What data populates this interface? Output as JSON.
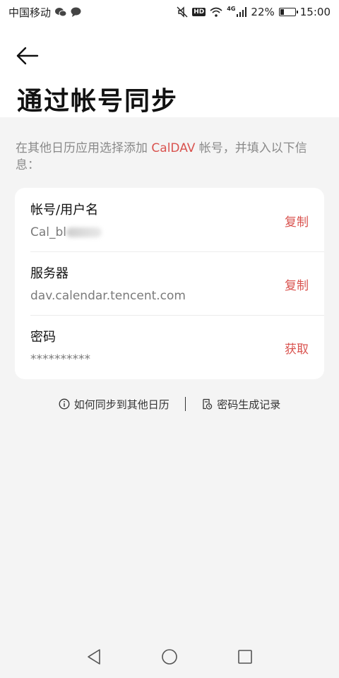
{
  "status_bar": {
    "carrier": "中国移动",
    "network": "4G",
    "battery_percent_text": "22%",
    "battery_level": 0.22,
    "time": "15:00",
    "hd": "HD"
  },
  "header": {
    "title": "通过帐号同步"
  },
  "description": {
    "before": "在其他日历应用选择添加 ",
    "accent": "CalDAV",
    "after": " 帐号，并填入以下信息："
  },
  "fields": [
    {
      "label": "帐号/用户名",
      "value": "Cal_bl",
      "action": "复制"
    },
    {
      "label": "服务器",
      "value": "dav.calendar.tencent.com",
      "action": "复制"
    },
    {
      "label": "密码",
      "value": "**********",
      "action": "获取"
    }
  ],
  "links": {
    "how_to_sync": "如何同步到其他日历",
    "password_history": "密码生成记录"
  },
  "colors": {
    "accent": "#d9534f",
    "background": "#f4f4f4"
  }
}
